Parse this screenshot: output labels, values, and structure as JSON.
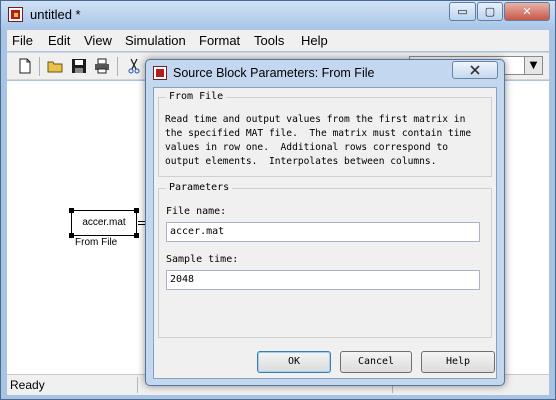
{
  "window": {
    "title": "untitled *",
    "controls": {
      "minimize": "▭",
      "maximize": "▢",
      "close": "✕"
    }
  },
  "menubar": [
    "File",
    "Edit",
    "View",
    "Simulation",
    "Format",
    "Tools",
    "Help"
  ],
  "toolbar": {
    "icons": [
      "new-file-icon",
      "open-folder-icon",
      "save-icon",
      "print-icon",
      "cut-icon"
    ]
  },
  "canvas": {
    "block": {
      "text": "accer.mat",
      "label": "From File"
    }
  },
  "status": {
    "text": "Ready"
  },
  "dialog": {
    "title": "Source Block Parameters: From File",
    "group_title": "From File",
    "description": "Read time and output values from the first matrix in\nthe specified MAT file.  The matrix must contain time\nvalues in row one.  Additional rows correspond to\noutput elements.  Interpolates between columns.",
    "params_title": "Parameters",
    "file_name_label": "File name:",
    "file_name_value": "accer.mat",
    "sample_time_label": "Sample time:",
    "sample_time_value": "2048",
    "buttons": {
      "ok": "OK",
      "cancel": "Cancel",
      "help": "Help"
    }
  }
}
